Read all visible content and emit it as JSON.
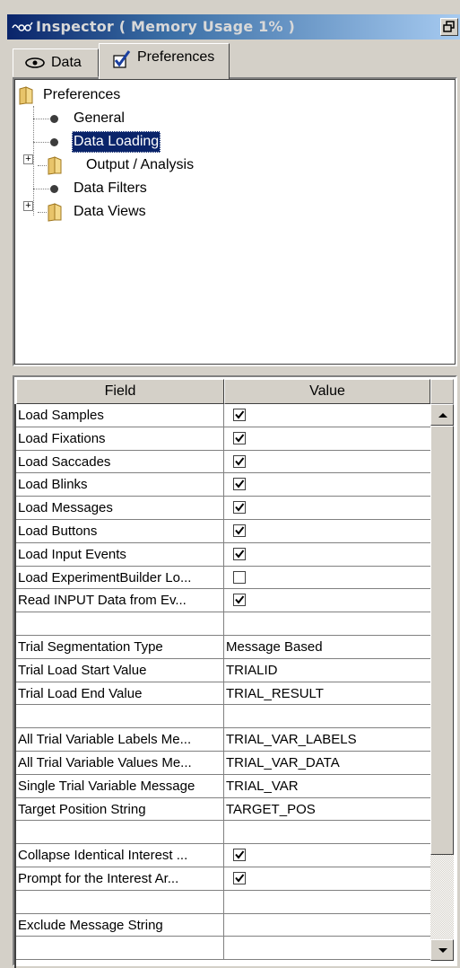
{
  "window": {
    "title": "Inspector ( Memory Usage 1% )"
  },
  "tabs": [
    {
      "label": "Data",
      "icon": "eye-icon",
      "active": false
    },
    {
      "label": "Preferences",
      "icon": "checkmark-icon",
      "active": true
    }
  ],
  "tree": {
    "root": "Preferences",
    "items": [
      {
        "label": "General",
        "type": "leaf"
      },
      {
        "label": "Data Loading",
        "type": "leaf",
        "selected": true
      },
      {
        "label": "Output / Analysis",
        "type": "folder",
        "expandable": true
      },
      {
        "label": "Data Filters",
        "type": "leaf"
      },
      {
        "label": "Data Views",
        "type": "folder",
        "expandable": true
      }
    ]
  },
  "grid": {
    "headers": {
      "field": "Field",
      "value": "Value"
    },
    "rows": [
      {
        "field": "Load Samples",
        "type": "checkbox",
        "checked": true
      },
      {
        "field": "Load Fixations",
        "type": "checkbox",
        "checked": true
      },
      {
        "field": "Load Saccades",
        "type": "checkbox",
        "checked": true
      },
      {
        "field": "Load Blinks",
        "type": "checkbox",
        "checked": true
      },
      {
        "field": "Load Messages",
        "type": "checkbox",
        "checked": true
      },
      {
        "field": "Load Buttons",
        "type": "checkbox",
        "checked": true
      },
      {
        "field": "Load Input Events",
        "type": "checkbox",
        "checked": true
      },
      {
        "field": "Load ExperimentBuilder Lo...",
        "type": "checkbox",
        "checked": false
      },
      {
        "field": "Read INPUT Data from Ev...",
        "type": "checkbox",
        "checked": true
      },
      {
        "field": "",
        "type": "blank"
      },
      {
        "field": "Trial Segmentation Type",
        "type": "text",
        "value": "Message Based"
      },
      {
        "field": "Trial Load Start Value",
        "type": "text",
        "value": "TRIALID"
      },
      {
        "field": "Trial Load End Value",
        "type": "text",
        "value": "TRIAL_RESULT"
      },
      {
        "field": "",
        "type": "blank"
      },
      {
        "field": "All Trial Variable Labels Me...",
        "type": "text",
        "value": "TRIAL_VAR_LABELS"
      },
      {
        "field": "All Trial Variable Values Me...",
        "type": "text",
        "value": "TRIAL_VAR_DATA"
      },
      {
        "field": "Single Trial Variable Message",
        "type": "text",
        "value": "TRIAL_VAR"
      },
      {
        "field": "Target Position String",
        "type": "text",
        "value": "TARGET_POS"
      },
      {
        "field": "",
        "type": "blank"
      },
      {
        "field": "Collapse Identical Interest ...",
        "type": "checkbox",
        "checked": true
      },
      {
        "field": "Prompt for the Interest Ar...",
        "type": "checkbox",
        "checked": true
      },
      {
        "field": "",
        "type": "blank"
      },
      {
        "field": "Exclude Message String",
        "type": "text",
        "value": ""
      },
      {
        "field": "",
        "type": "blank"
      }
    ]
  }
}
